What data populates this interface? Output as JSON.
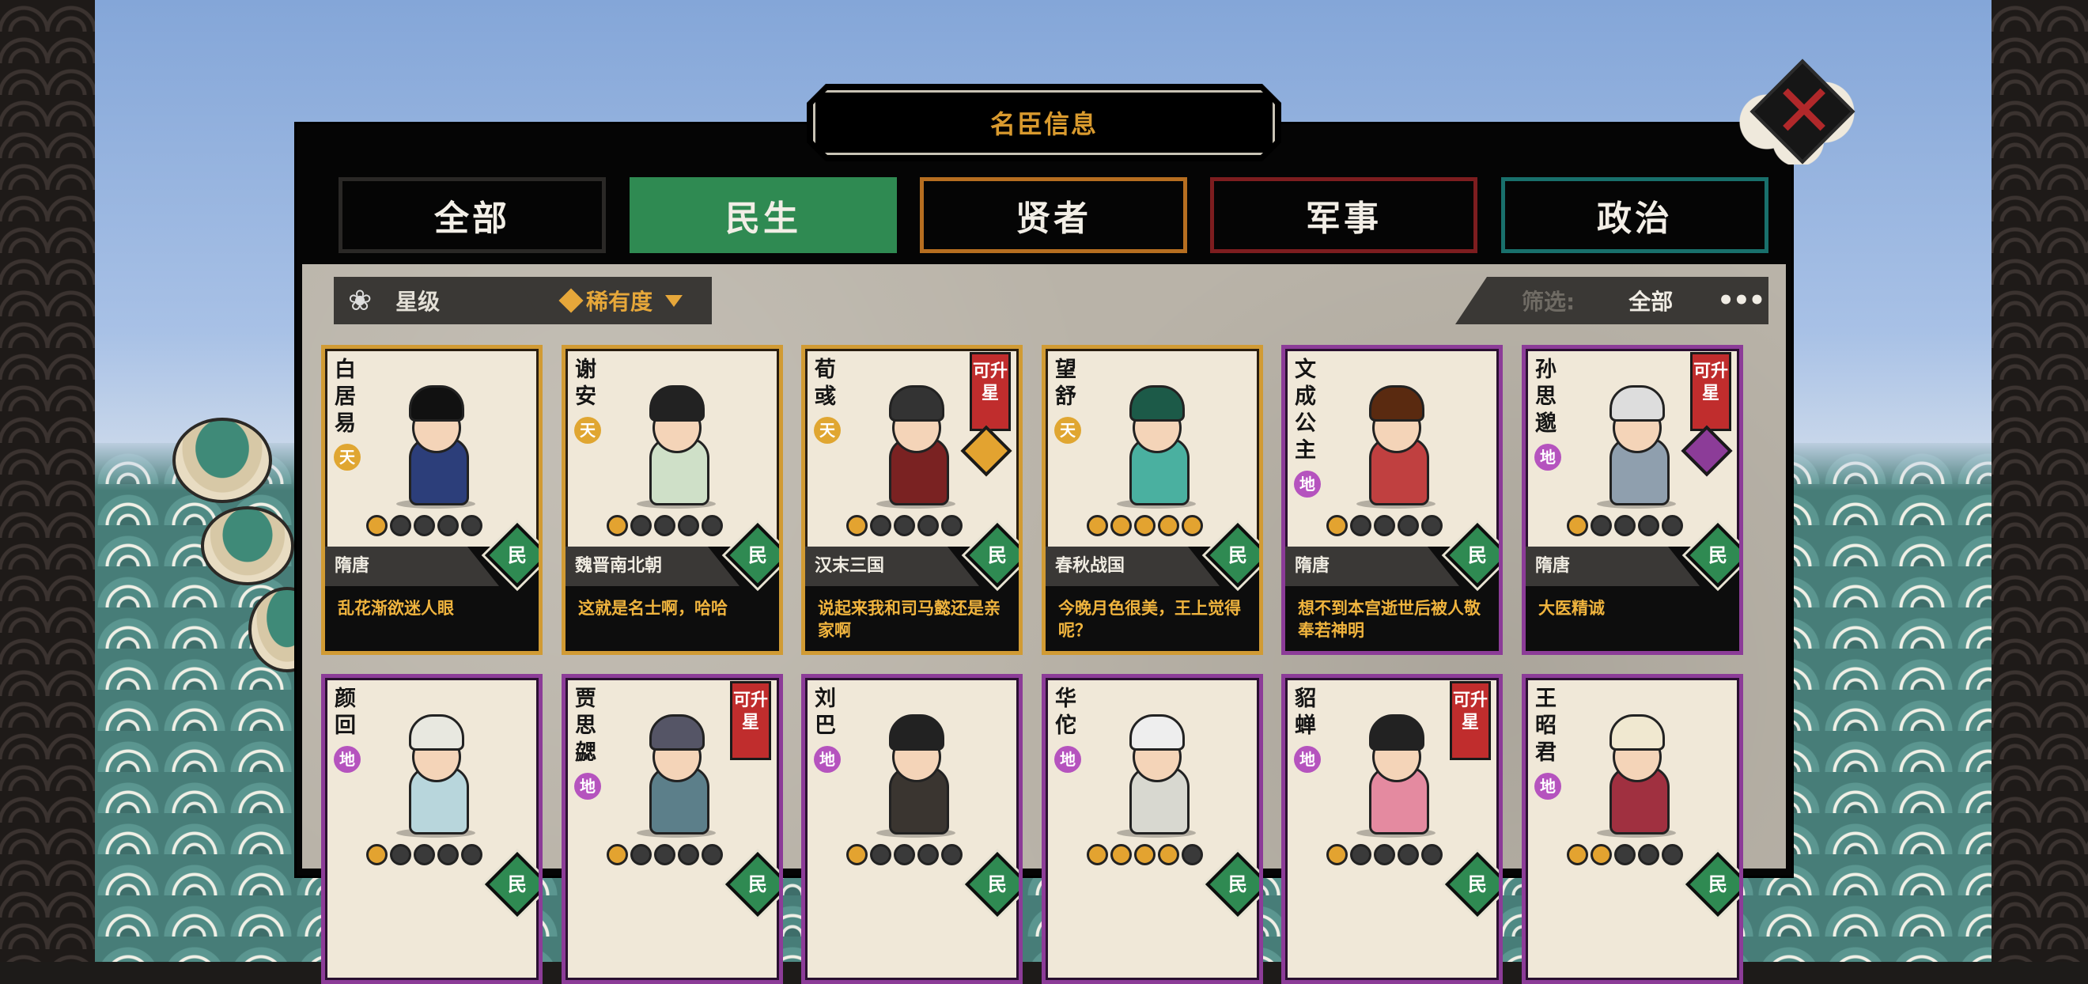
{
  "title": "名臣信息",
  "tabs": [
    {
      "label": "全部"
    },
    {
      "label": "民生"
    },
    {
      "label": "贤者"
    },
    {
      "label": "军事"
    },
    {
      "label": "政治"
    }
  ],
  "active_tab": "民生",
  "sort": {
    "star_label": "星级",
    "rarity_label": "稀有度"
  },
  "filter": {
    "label": "筛选:",
    "value": "全部",
    "more": "•••"
  },
  "type_badge": "民",
  "upgrade_label": "可升星",
  "cards": [
    {
      "name": "白居易",
      "grade": "天",
      "stars": 1,
      "era": "隋唐",
      "quote": "乱花渐欲迷人眼",
      "frame": "gold",
      "upgrade": false
    },
    {
      "name": "谢安",
      "grade": "天",
      "stars": 1,
      "era": "魏晋南北朝",
      "quote": "这就是名士啊，哈哈",
      "frame": "gold",
      "upgrade": false
    },
    {
      "name": "荀彧",
      "grade": "天",
      "stars": 1,
      "era": "汉末三国",
      "quote": "说起来我和司马懿还是亲家啊",
      "frame": "gold",
      "upgrade": true
    },
    {
      "name": "望舒",
      "grade": "天",
      "stars": 5,
      "era": "春秋战国",
      "quote": "今晚月色很美，王上觉得呢？",
      "frame": "gold",
      "upgrade": false
    },
    {
      "name": "文成公主",
      "grade": "地",
      "stars": 1,
      "era": "隋唐",
      "quote": "想不到本宫逝世后被人敬奉若神明",
      "frame": "purple",
      "upgrade": false
    },
    {
      "name": "孙思邈",
      "grade": "地",
      "stars": 1,
      "era": "隋唐",
      "quote": "大医精诚",
      "frame": "purple",
      "upgrade": true
    },
    {
      "name": "颜回",
      "grade": "地",
      "stars": 1,
      "frame": "purple",
      "upgrade": false
    },
    {
      "name": "贾思勰",
      "grade": "地",
      "stars": 1,
      "frame": "purple",
      "upgrade": true
    },
    {
      "name": "刘巴",
      "grade": "地",
      "stars": 1,
      "frame": "purple",
      "upgrade": false
    },
    {
      "name": "华佗",
      "grade": "地",
      "stars": 4,
      "frame": "purple",
      "upgrade": false
    },
    {
      "name": "貂蝉",
      "grade": "地",
      "stars": 1,
      "frame": "purple",
      "upgrade": true
    },
    {
      "name": "王昭君",
      "grade": "地",
      "stars": 2,
      "frame": "purple",
      "upgrade": false
    }
  ],
  "colors": {
    "active_tab": "#2f8a52",
    "sage_border": "#b66e20",
    "military_border": "#7d1d1f",
    "politics_border": "#19706c",
    "gold_frame": "#d19b34",
    "purple_frame": "#8c3c98",
    "quote_text": "#f0b43e",
    "close_x": "#b0282a"
  },
  "icons": [
    "close-icon",
    "flower-icon",
    "diamond-icon",
    "dropdown-triangle-icon",
    "more-icon"
  ]
}
